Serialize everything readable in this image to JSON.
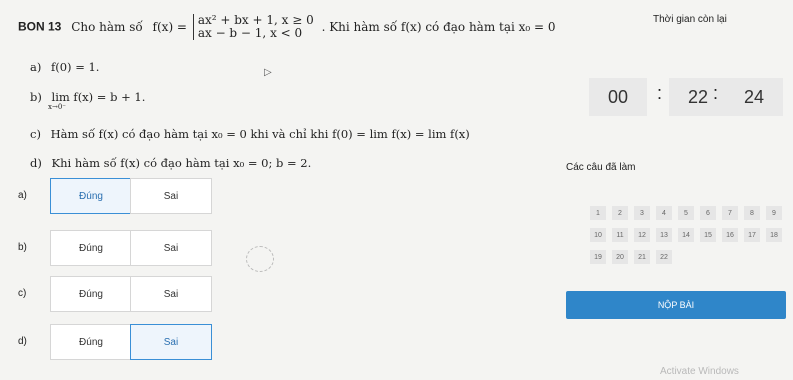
{
  "question": {
    "number": "BON 13",
    "intro": "Cho hàm số",
    "func": "f(x) =",
    "case1": "ax² + bx + 1, x ≥ 0",
    "case2": "ax − b − 1, x < 0",
    "suffix": ". Khi hàm số f(x) có đạo hàm tại x₀ = 0"
  },
  "statements": [
    {
      "letter": "a)",
      "text": "f(0) = 1."
    },
    {
      "letter": "b)",
      "text": "lim f(x) = b + 1.",
      "sub": "x→0⁻"
    },
    {
      "letter": "c)",
      "text": "Hàm số f(x) có đạo hàm tại x₀ = 0 khi và chỉ khi f(0) = lim f(x) = lim f(x)"
    },
    {
      "letter": "d)",
      "text": "Khi hàm số f(x) có đạo hàm tại x₀ = 0; b = 2."
    }
  ],
  "timer": {
    "label": "Thời gian còn lại",
    "h": "00",
    "m": "22",
    "s": "24"
  },
  "answers": [
    {
      "letter": "a)",
      "true_label": "Đúng",
      "false_label": "Sai",
      "selected": "true"
    },
    {
      "letter": "b)",
      "true_label": "Đúng",
      "false_label": "Sai",
      "selected": "none"
    },
    {
      "letter": "c)",
      "true_label": "Đúng",
      "false_label": "Sai",
      "selected": "none"
    },
    {
      "letter": "d)",
      "true_label": "Đúng",
      "false_label": "Sai",
      "selected": "false"
    }
  ],
  "done_panel": {
    "label": "Các câu đã làm",
    "numbers": [
      "1",
      "2",
      "3",
      "4",
      "5",
      "6",
      "7",
      "8",
      "9",
      "10",
      "11",
      "12",
      "13",
      "14",
      "15",
      "16",
      "17",
      "18",
      "19",
      "20",
      "21",
      "22"
    ],
    "done": [
      "1",
      "2",
      "3",
      "4",
      "5",
      "6",
      "7",
      "8",
      "9",
      "10",
      "11",
      "12",
      "13",
      "14",
      "15",
      "16",
      "17",
      "18",
      "19",
      "20",
      "21",
      "22"
    ]
  },
  "submit_label": "NỘP BÀI",
  "watermark": "Activate Windows",
  "colors": {
    "accent": "#2f86c9",
    "selected_border": "#3a8fd6"
  }
}
